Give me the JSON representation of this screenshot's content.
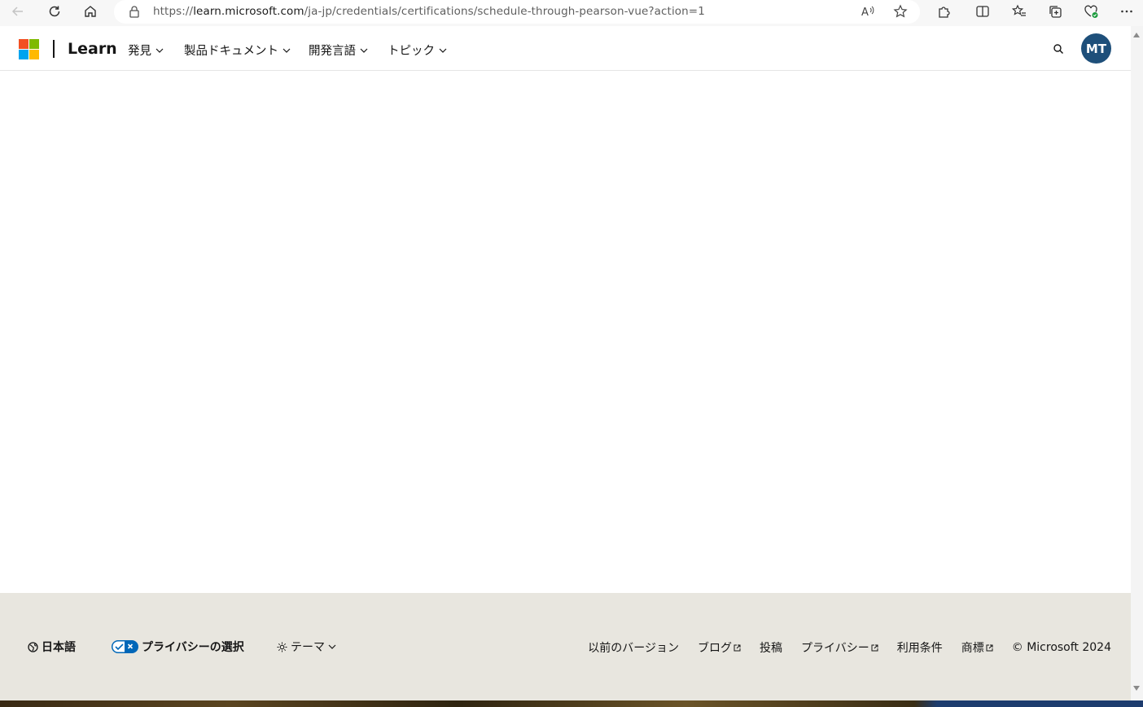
{
  "browser": {
    "url_prefix": "https://",
    "url_host": "learn.microsoft.com",
    "url_path": "/ja-jp/credentials/certifications/schedule-through-pearson-vue?action=1"
  },
  "header": {
    "brand": "Learn",
    "nav": [
      {
        "label": "発見"
      },
      {
        "label": "製品ドキュメント"
      },
      {
        "label": "開発言語"
      },
      {
        "label": "トピック"
      }
    ],
    "avatar_initials": "MT"
  },
  "footer": {
    "language": "日本語",
    "privacy_choices": "プライバシーの選択",
    "theme": "テーマ",
    "links": [
      {
        "label": "以前のバージョン",
        "external": false
      },
      {
        "label": "ブログ",
        "external": true
      },
      {
        "label": "投稿",
        "external": false
      },
      {
        "label": "プライバシー",
        "external": true
      },
      {
        "label": "利用条件",
        "external": false
      },
      {
        "label": "商標",
        "external": true
      }
    ],
    "copyright": "© Microsoft 2024"
  },
  "colors": {
    "avatar_bg": "#1e4f7a",
    "footer_bg": "#e8e6df",
    "logo_red": "#f25022",
    "logo_green": "#7fba00",
    "logo_blue": "#00a4ef",
    "logo_yellow": "#ffb900"
  }
}
